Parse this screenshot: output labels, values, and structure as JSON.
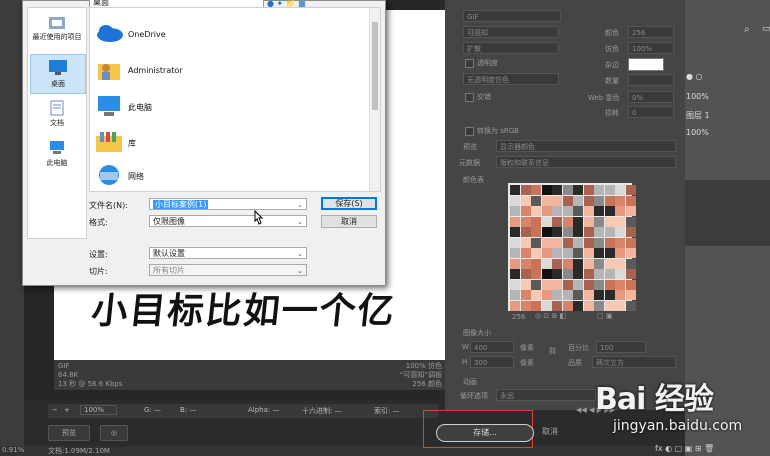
{
  "photoshop": {
    "preview_text": "小目标比如一个亿",
    "preview_info_left": [
      "GIF",
      "64.8K",
      "13 秒 @ 56.6 Kbps"
    ],
    "preview_info_right": [
      "100% 仿色",
      "“可感知”调板",
      "256 颜色"
    ],
    "status": {
      "zoom": "100%",
      "g": "G: —",
      "b": "B: —",
      "alpha": "Alpha: —",
      "hex": "十六进制: —",
      "index": "索引: —"
    },
    "preview_button": "预览",
    "bottom_status": "文档:1.09M/2.10M",
    "zoom_left": "0.91%"
  },
  "panel": {
    "format": "GIF",
    "reduction": "可感知",
    "dither": "扩散",
    "transparency": "透明度",
    "matte_label": "杂边",
    "no_transparency_dither": "无透明度仿色",
    "interlaced": "交错",
    "colors_label": "颜色",
    "colors_value": "256",
    "dither_label": "仿色",
    "dither_value": "100%",
    "amount_label": "数量",
    "web_snap_label": "Web 靠色",
    "web_snap_value": "0%",
    "lossy_label": "损耗",
    "lossy_value": "0",
    "convert_srgb": "转换为 sRGB",
    "preview_label": "预览",
    "preview_value": "显示器颜色",
    "metadata_label": "元数据",
    "metadata_value": "版权和联系信息",
    "color_table_label": "颜色表",
    "palette_count": "256",
    "image_size_label": "图像大小",
    "w_label": "W",
    "w_value": "400",
    "h_label": "H",
    "h_value": "300",
    "px_unit": "像素",
    "percent_label": "百分比",
    "percent_value": "100",
    "quality_label": "品质",
    "quality_value": "两次立方",
    "animation_label": "动画",
    "loop_label": "循环选项",
    "loop_value": "永远",
    "save_button": "存储...",
    "cancel_button": "取消"
  },
  "layers": {
    "opacity_value": "100%",
    "name": "图层 1"
  },
  "dialog": {
    "location": "桌面",
    "nav": [
      {
        "label": "最近使用的项目"
      },
      {
        "label": "桌面"
      },
      {
        "label": "文档"
      },
      {
        "label": "此电脑"
      }
    ],
    "files": [
      {
        "name": "OneDrive"
      },
      {
        "name": "Administrator"
      },
      {
        "name": "此电脑"
      },
      {
        "name": "库"
      },
      {
        "name": "网络"
      }
    ],
    "filename_label": "文件名(N):",
    "filename_value": "小目标案例(1)",
    "format_label": "格式:",
    "format_value": "仅限图像",
    "settings_label": "设置:",
    "settings_value": "默认设置",
    "slices_label": "切片:",
    "slices_value": "所有切片",
    "save_button": "保存(S)",
    "cancel_button": "取消"
  },
  "watermark": {
    "logo": "Bai 经验",
    "url": "jingyan.baidu.com"
  }
}
